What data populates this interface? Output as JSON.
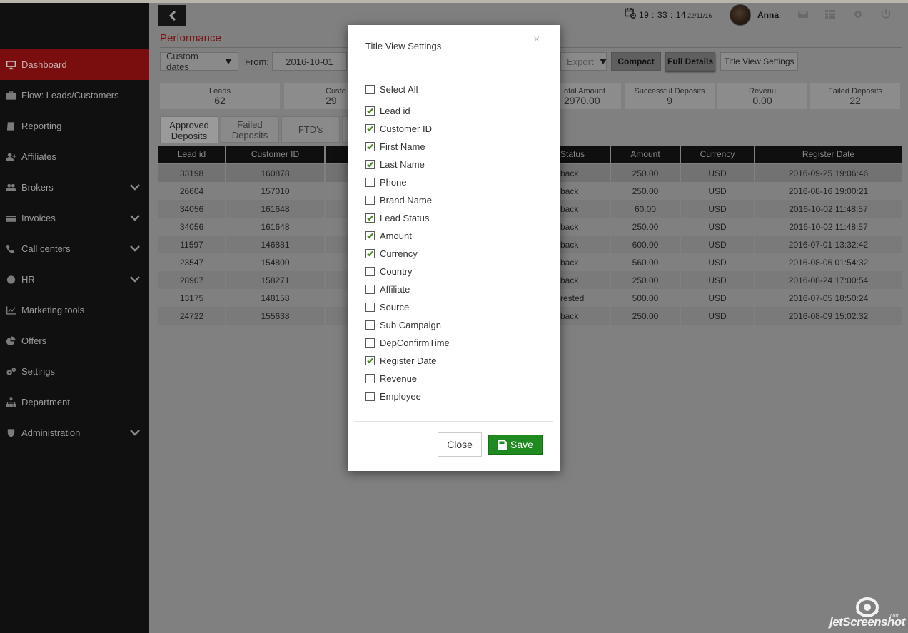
{
  "sidebar": {
    "items": [
      {
        "label": "Dashboard",
        "icon": "monitor-icon",
        "active": true,
        "expandable": false
      },
      {
        "label": "Flow: Leads/Customers",
        "icon": "briefcase-icon",
        "active": false,
        "expandable": false
      },
      {
        "label": "Reporting",
        "icon": "book-icon",
        "active": false,
        "expandable": false
      },
      {
        "label": "Affiliates",
        "icon": "user-plus-icon",
        "active": false,
        "expandable": false
      },
      {
        "label": "Brokers",
        "icon": "users-icon",
        "active": false,
        "expandable": true
      },
      {
        "label": "Invoices",
        "icon": "credit-card-icon",
        "active": false,
        "expandable": true
      },
      {
        "label": "Call centers",
        "icon": "phone-icon",
        "active": false,
        "expandable": true
      },
      {
        "label": "HR",
        "icon": "globe-icon",
        "active": false,
        "expandable": true
      },
      {
        "label": "Marketing tools",
        "icon": "chart-line-icon",
        "active": false,
        "expandable": false
      },
      {
        "label": "Offers",
        "icon": "pie-chart-icon",
        "active": false,
        "expandable": false
      },
      {
        "label": "Settings",
        "icon": "gears-icon",
        "active": false,
        "expandable": false
      },
      {
        "label": "Department",
        "icon": "sitemap-icon",
        "active": false,
        "expandable": false
      },
      {
        "label": "Administration",
        "icon": "shield-icon",
        "active": false,
        "expandable": true
      }
    ]
  },
  "header": {
    "time": "19 : 33 : 14",
    "date": "22/11/16",
    "username": "Anna"
  },
  "page": {
    "title": "Performance"
  },
  "toolbar": {
    "date_range": "Custom dates",
    "from_label": "From:",
    "from_value": "2016-10-01",
    "export_label": "Export",
    "compact_label": "Compact",
    "full_details_label": "Full Details",
    "title_view_settings_label": "Title View Settings"
  },
  "stats": {
    "leads_label": "Leads",
    "leads_value": "62",
    "customers_label": "Custo",
    "customers_value": "29",
    "total_amount_label": "otal Amount",
    "total_amount_value": "2970.00",
    "successful_label": "Successful Deposits",
    "successful_value": "9",
    "revenue_label": "Revenu",
    "revenue_value": "0.00",
    "failed_label": "Failed Deposits",
    "failed_value": "22"
  },
  "tabs": {
    "approved_line1": "Approved",
    "approved_line2": "Deposits",
    "failed_line1": "Failed",
    "failed_line2": "Deposits",
    "ftds": "FTD's"
  },
  "table": {
    "headers": {
      "lead_id": "Lead id",
      "customer_id": "Customer ID",
      "status": "Status",
      "amount": "Amount",
      "currency": "Currency",
      "register_date": "Register Date"
    },
    "rows": [
      {
        "lead_id": "33198",
        "customer_id": "160878",
        "status": "back",
        "amount": "250.00",
        "currency": "USD",
        "register_date": "2016-09-25 19:06:46"
      },
      {
        "lead_id": "26604",
        "customer_id": "157010",
        "status": "back",
        "amount": "250.00",
        "currency": "USD",
        "register_date": "2016-08-16 19:00:21"
      },
      {
        "lead_id": "34056",
        "customer_id": "161648",
        "status": "back",
        "amount": "60.00",
        "currency": "USD",
        "register_date": "2016-10-02 11:48:57"
      },
      {
        "lead_id": "34056",
        "customer_id": "161648",
        "status": "back",
        "amount": "250.00",
        "currency": "USD",
        "register_date": "2016-10-02 11:48:57"
      },
      {
        "lead_id": "11597",
        "customer_id": "146881",
        "status": "back",
        "amount": "600.00",
        "currency": "USD",
        "register_date": "2016-07-01 13:32:42"
      },
      {
        "lead_id": "23547",
        "customer_id": "154800",
        "status": "back",
        "amount": "560.00",
        "currency": "USD",
        "register_date": "2016-08-06 01:54:32"
      },
      {
        "lead_id": "28907",
        "customer_id": "158271",
        "status": "back",
        "amount": "250.00",
        "currency": "USD",
        "register_date": "2016-08-24 17:00:54"
      },
      {
        "lead_id": "13175",
        "customer_id": "148158",
        "status": "rested",
        "amount": "500.00",
        "currency": "USD",
        "register_date": "2016-07-05 18:50:24"
      },
      {
        "lead_id": "24722",
        "customer_id": "155638",
        "status": "back",
        "amount": "250.00",
        "currency": "USD",
        "register_date": "2016-08-09 15:02:32"
      }
    ]
  },
  "modal": {
    "title": "Title View Settings",
    "close_x": "×",
    "options": [
      {
        "label": "Select All",
        "checked": false
      },
      {
        "label": "Lead id",
        "checked": true
      },
      {
        "label": "Customer ID",
        "checked": true
      },
      {
        "label": "First Name",
        "checked": true
      },
      {
        "label": "Last Name",
        "checked": true
      },
      {
        "label": "Phone",
        "checked": false
      },
      {
        "label": "Brand Name",
        "checked": false
      },
      {
        "label": "Lead Status",
        "checked": true
      },
      {
        "label": "Amount",
        "checked": true
      },
      {
        "label": "Currency",
        "checked": true
      },
      {
        "label": "Country",
        "checked": false
      },
      {
        "label": "Affiliate",
        "checked": false
      },
      {
        "label": "Source",
        "checked": false
      },
      {
        "label": "Sub Campaign",
        "checked": false
      },
      {
        "label": "DepConfirmTime",
        "checked": false
      },
      {
        "label": "Register Date",
        "checked": true
      },
      {
        "label": "Revenue",
        "checked": false
      },
      {
        "label": "Employee",
        "checked": false
      }
    ],
    "close_button": "Close",
    "save_button": "Save"
  },
  "watermark": {
    "brand": "jetScreenshot",
    "suffix": ".com"
  },
  "colors": {
    "accent_red": "#7a0e0e",
    "title_red": "#7a1010",
    "save_green": "#1f8a1f",
    "check_green": "#4a8a1c"
  }
}
